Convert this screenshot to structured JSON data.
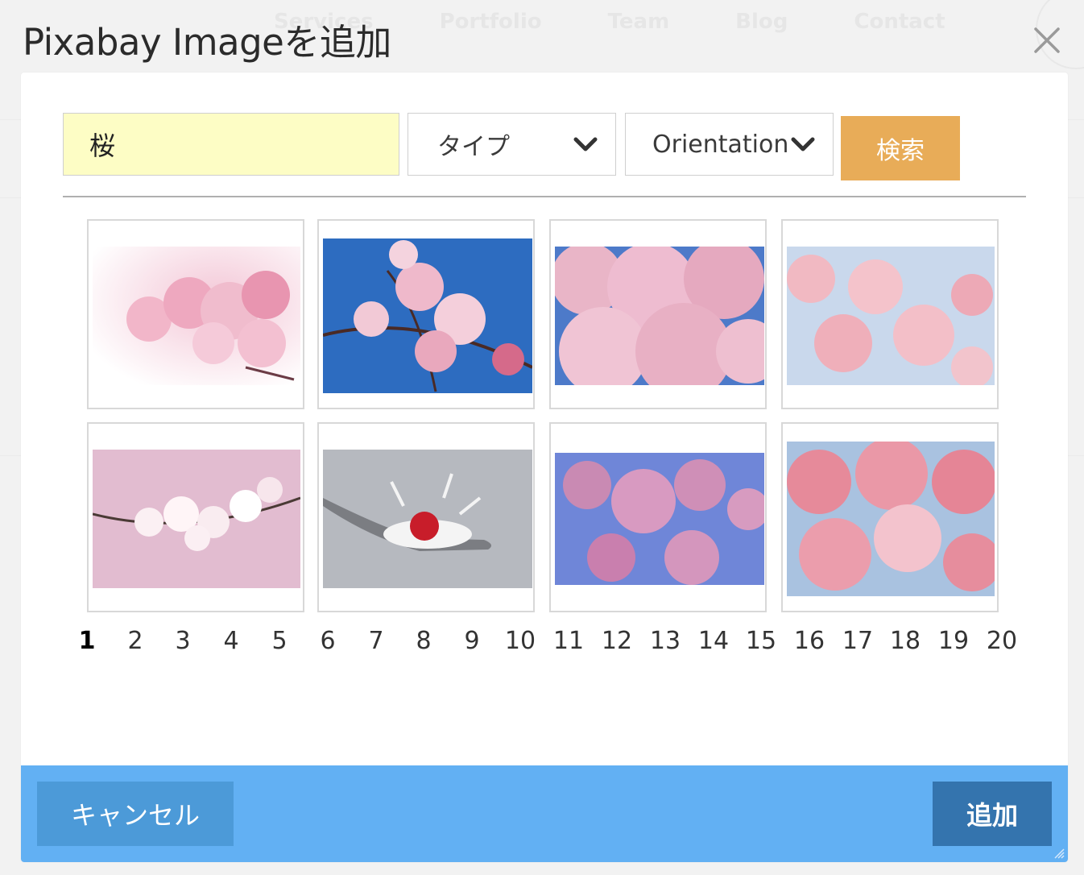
{
  "background": {
    "nav": [
      "Services",
      "Portfolio",
      "Team",
      "Blog",
      "Contact"
    ]
  },
  "dialog": {
    "title": "Pixabay Imageを追加",
    "search": {
      "value": "桜"
    },
    "type_select": {
      "label": "タイプ"
    },
    "orientation_select": {
      "label": "Orientation"
    },
    "search_button": "検索",
    "pagination": [
      "1",
      "2",
      "3",
      "4",
      "5",
      "6",
      "7",
      "8",
      "9",
      "10",
      "11",
      "12",
      "13",
      "14",
      "15",
      "16",
      "17",
      "18",
      "19",
      "20"
    ],
    "current_page": "1",
    "cancel_button": "キャンセル",
    "add_button": "追加"
  },
  "colors": {
    "search_button": "#e8ac58",
    "footer": "#62b0f3",
    "cancel_button": "#4c9ad8",
    "add_button": "#3474ae",
    "search_input_bg": "#fdfdc5"
  }
}
